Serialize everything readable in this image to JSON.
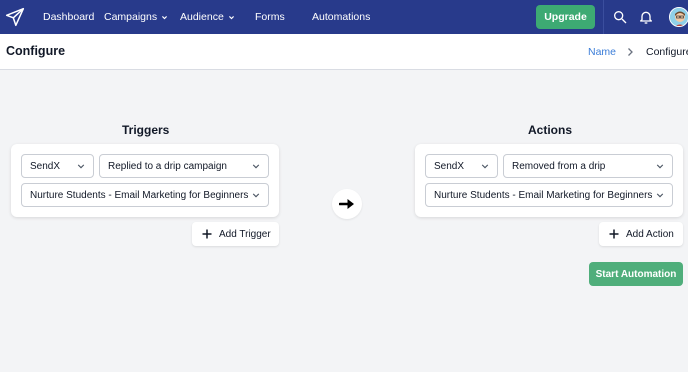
{
  "nav": {
    "items": [
      {
        "label": "Dashboard"
      },
      {
        "label": "Campaigns"
      },
      {
        "label": "Audience"
      },
      {
        "label": "Forms"
      },
      {
        "label": "Automations"
      }
    ],
    "upgrade_label": "Upgrade",
    "accent_color": "#283a8b",
    "upgrade_color": "#3daa73"
  },
  "header": {
    "title": "Configure",
    "breadcrumb": {
      "link": "Name",
      "current": "Configure"
    }
  },
  "triggers": {
    "title": "Triggers",
    "source_select": "SendX",
    "event_select": "Replied to a drip campaign",
    "campaign_select": "Nurture Students - Email Marketing for Beginners",
    "add_label": "Add Trigger"
  },
  "actions": {
    "title": "Actions",
    "source_select": "SendX",
    "event_select": "Removed from a drip",
    "campaign_select": "Nurture Students - Email Marketing for Beginners",
    "add_label": "Add Action"
  },
  "start_label": "Start Automation",
  "icons": [
    "paper-plane-icon",
    "chevron-down-icon",
    "search-icon",
    "bell-icon",
    "avatar",
    "chevron-right-icon",
    "arrow-right-icon",
    "plus-icon"
  ]
}
